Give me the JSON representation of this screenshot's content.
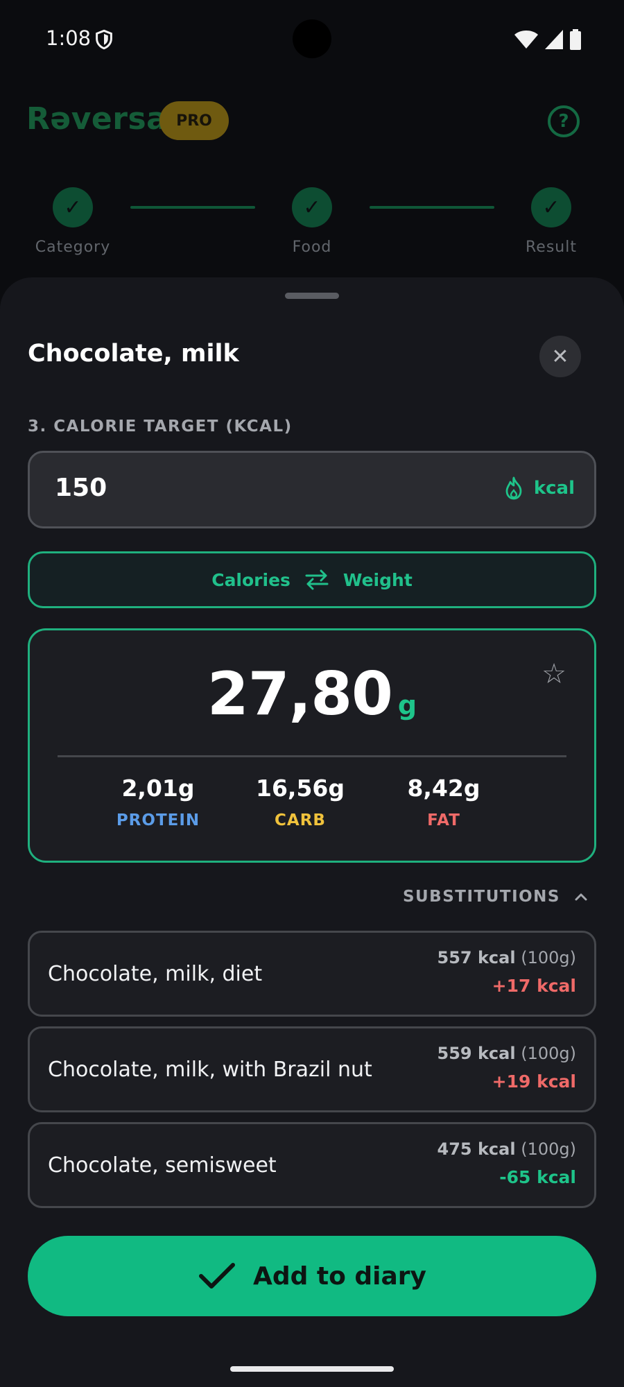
{
  "status_bar": {
    "time": "1:08"
  },
  "header": {
    "app_name": "Rəversa",
    "badge": "PRO",
    "help_icon": "question-circle-icon"
  },
  "stepper": {
    "steps": [
      {
        "label": "Category",
        "done": true
      },
      {
        "label": "Food",
        "done": true
      },
      {
        "label": "Result",
        "done": true
      }
    ]
  },
  "sheet": {
    "title": "Chocolate, milk",
    "section_label": "3. CALORIE TARGET (KCAL)",
    "calorie_input": {
      "value": "150",
      "unit": "kcal"
    },
    "toggle": {
      "left": "Calories",
      "right": "Weight"
    },
    "result": {
      "value": "27,80",
      "unit": "g",
      "macros": [
        {
          "value": "2,01g",
          "label": "PROTEIN",
          "color": "#5b9ce8"
        },
        {
          "value": "16,56g",
          "label": "CARB",
          "color": "#f0c23c"
        },
        {
          "value": "8,42g",
          "label": "FAT",
          "color": "#ef6a68"
        }
      ]
    },
    "substitutions": {
      "title": "SUBSTITUTIONS",
      "items": [
        {
          "name": "Chocolate, milk, diet",
          "kcal": "557 kcal",
          "per": "(100g)",
          "diff": "+17 kcal",
          "diff_color": "#ef6a68"
        },
        {
          "name": "Chocolate, milk, with Brazil nut",
          "kcal": "559 kcal",
          "per": "(100g)",
          "diff": "+19 kcal",
          "diff_color": "#ef6a68"
        },
        {
          "name": "Chocolate, semisweet",
          "kcal": "475 kcal",
          "per": "(100g)",
          "diff": "-65 kcal",
          "diff_color": "#1ec48a"
        }
      ]
    },
    "add_button": "Add to diary"
  },
  "colors": {
    "accent": "#1ec48a",
    "button": "#11ba82",
    "sheet_bg": "#16171c"
  }
}
